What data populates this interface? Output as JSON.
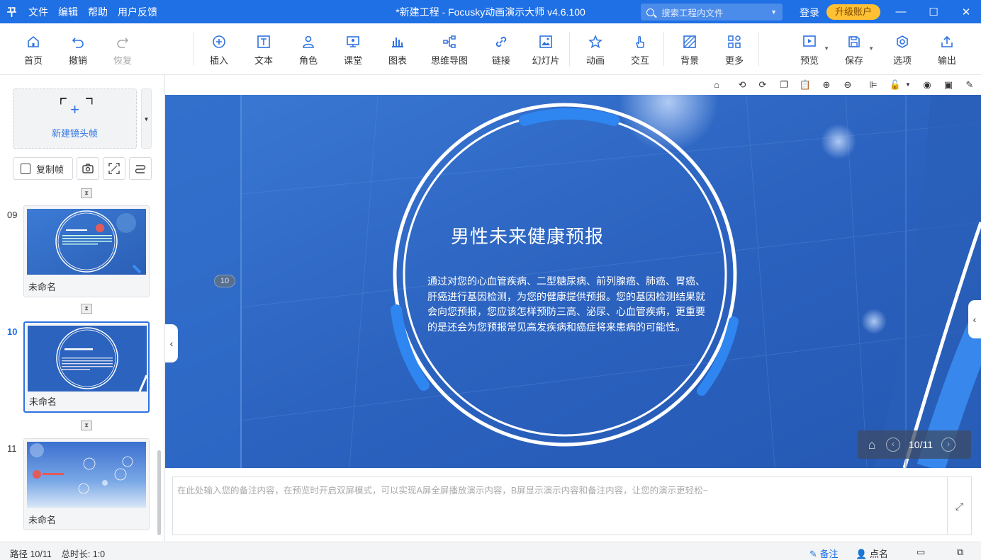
{
  "titlebar": {
    "logo": "꾸",
    "menu": [
      "文件",
      "编辑",
      "帮助",
      "用户反馈"
    ],
    "title": "*新建工程 - Focusky动画演示大师  v4.6.100",
    "search_placeholder": "搜索工程内文件",
    "login": "登录",
    "upgrade": "升级账户",
    "accent": "#1f6fe5"
  },
  "toolbar": {
    "home": "首页",
    "undo": "撤销",
    "redo": "恢复",
    "insert": "插入",
    "text": "文本",
    "role": "角色",
    "class": "课堂",
    "chart": "图表",
    "mindmap": "思维导图",
    "link": "链接",
    "slides": "幻灯片",
    "animation": "动画",
    "interact": "交互",
    "background": "背景",
    "more": "更多",
    "preview": "预览",
    "save": "保存",
    "options": "选项",
    "export": "输出"
  },
  "left_panel": {
    "new_frame": "新建镜头帧",
    "copy_frame": "复制帧",
    "frames": [
      {
        "number": "09",
        "name": "未命名",
        "active": false
      },
      {
        "number": "10",
        "name": "未命名",
        "active": true
      },
      {
        "number": "11",
        "name": "未命名",
        "active": false
      }
    ]
  },
  "slide": {
    "title": "男性未来健康预报",
    "body": "通过对您的心血管疾病、二型糖尿病、前列腺癌、肺癌、胃癌、肝癌进行基因检测，为您的健康提供预报。您的基因检测结果就会向您预报，您应该怎样预防三高、泌尿、心血管疾病，更重要的是还会为您预报常见高发疾病和癌症将来患病的可能性。",
    "path_badge": "10",
    "page_indicator": "10/11"
  },
  "notes": {
    "placeholder": "在此处输入您的备注内容，在预览时开启双屏模式，可以实现A屏全屏播放演示内容，B屏显示演示内容和备注内容，让您的演示更轻松~"
  },
  "statusbar": {
    "path": "路径 10/11",
    "duration": "总时长: 1:0",
    "notes_btn": "备注",
    "roll_call": "点名"
  }
}
